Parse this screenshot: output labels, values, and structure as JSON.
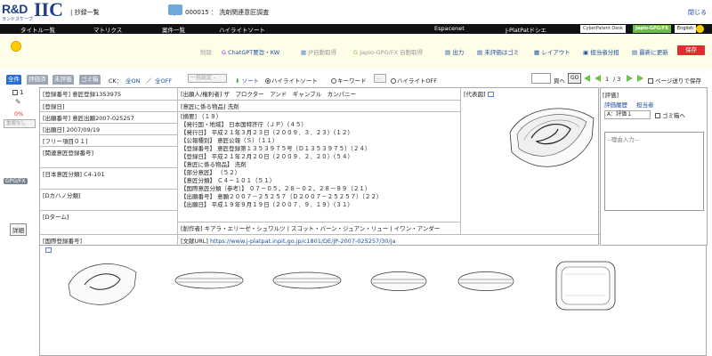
{
  "header": {
    "logo_text": "R&D",
    "logo_iic": "IIC",
    "logo_sub": "ランドスケープ",
    "title": "| 抄録一覧",
    "case_number": "000015",
    "case_name": "洗剤関連意匠調査",
    "close_label": "閉じる"
  },
  "nav": {
    "items": [
      "タイトル一覧",
      "マトリクス",
      "案件一覧",
      "ハイライトソート",
      "Espacenet",
      "J-PlatPatドシエ"
    ],
    "badges": [
      "CyberPatent Desk",
      "Japio-GPG/FX",
      "English"
    ]
  },
  "toolbar": {
    "items": [
      "削除",
      "ChatGPT要旨・KW",
      "JP自動取得",
      "Japio-GPG/FX 自動取得",
      "出力",
      "未評価はゴミ",
      "レイアウト",
      "担当者分担",
      "最新に更新"
    ],
    "save_label": "保存"
  },
  "controls": {
    "tabs": [
      "全件",
      "評価済",
      "未評価",
      "ゴミ箱"
    ],
    "ck_label": "CK：",
    "all_on": "全ON",
    "sep": "／",
    "all_off": "全OFF",
    "select_placeholder": "一括設定 - ",
    "sort_label": "ソート",
    "radio_highlight": "ハイライトソート",
    "radio_keyword": "キーワード",
    "radio_off": "ハイライトOFF",
    "keyword_btn": "...",
    "page_label": "頁へ",
    "go_label": "GO",
    "page_current": "1",
    "page_total": "/ 3",
    "page_save_label": "ページ送りで保存"
  },
  "left": {
    "checkbox_label": "1",
    "percent": "0%",
    "status_select": "重複なし",
    "gpg_label": "GPG/FX",
    "detail_label": "詳細"
  },
  "record": {
    "reg_no": "[登録番号] 意匠登録1353975",
    "reg_date": "[登録日]",
    "app_no": "[出願番号] 意匠出願2007-025257",
    "app_date": "[出願日] 2007/09/19",
    "free1": "[フリー項目０１]",
    "related": "[関連意匠登録番号]",
    "jp_class": "[日本意匠分類] C4-101",
    "dterm_kana": "[Dカハノ分類]",
    "dterm": "[Dターム]",
    "intl_reg": "[国際登録番号]",
    "applicant": "[出願人/権利者] ザ　プロクター　アンド　ギャンブル　カンパニー",
    "article": "[意匠に係る物品] 洗剤",
    "abstract_title": "[摘要] （１９）",
    "abstract": [
      "【発行国・地域】 日本国特許庁（ＪＰ）（４５）",
      "【発行日】 平成２１年３月２３日（２００９．３．２３）（１２）",
      "【公報種別】 意匠公報（Ｓ）（１１）",
      "【登録番号】 意匠登録第１３５３９７５号（Ｄ１３５３９７５）（２４）",
      "【登録日】 平成２１年２月２０日（２００９．２．２０）（５４）",
      "【意匠に係る物品】 洗剤",
      "【部分意匠】 （５２）",
      "【意匠分類】 Ｃ４－１０１（５１）",
      "【国際意匠分類（参考）】 ０７－０５，２８－０２，２８－９９（２１）",
      "【出願番号】 意願２００７－２５２５７（Ｄ２００７－２５２５７）（２２）",
      "【出願日】 平成１９年９月１９日（２００７．９．１９）（３１）"
    ],
    "creator": "[創作者] キアラ・エリーゼ・シュワルツ | スコット・バーン・ジュアン・リュー | イワン・アンダー",
    "url_label": "[文献URL]",
    "url": "https://www.j-platpat.inpit.go.jp/c1801/DE/JP-2007-025257/30/ja",
    "figure_label": "[代表図]"
  },
  "evaluation": {
    "title": "[評価]",
    "history_link": "評価履歴",
    "assignee_link": "担当者",
    "eval_value": "A：評価１",
    "trash_label": "ゴミ箱へ",
    "reason_placeholder": "--理由入力--"
  }
}
